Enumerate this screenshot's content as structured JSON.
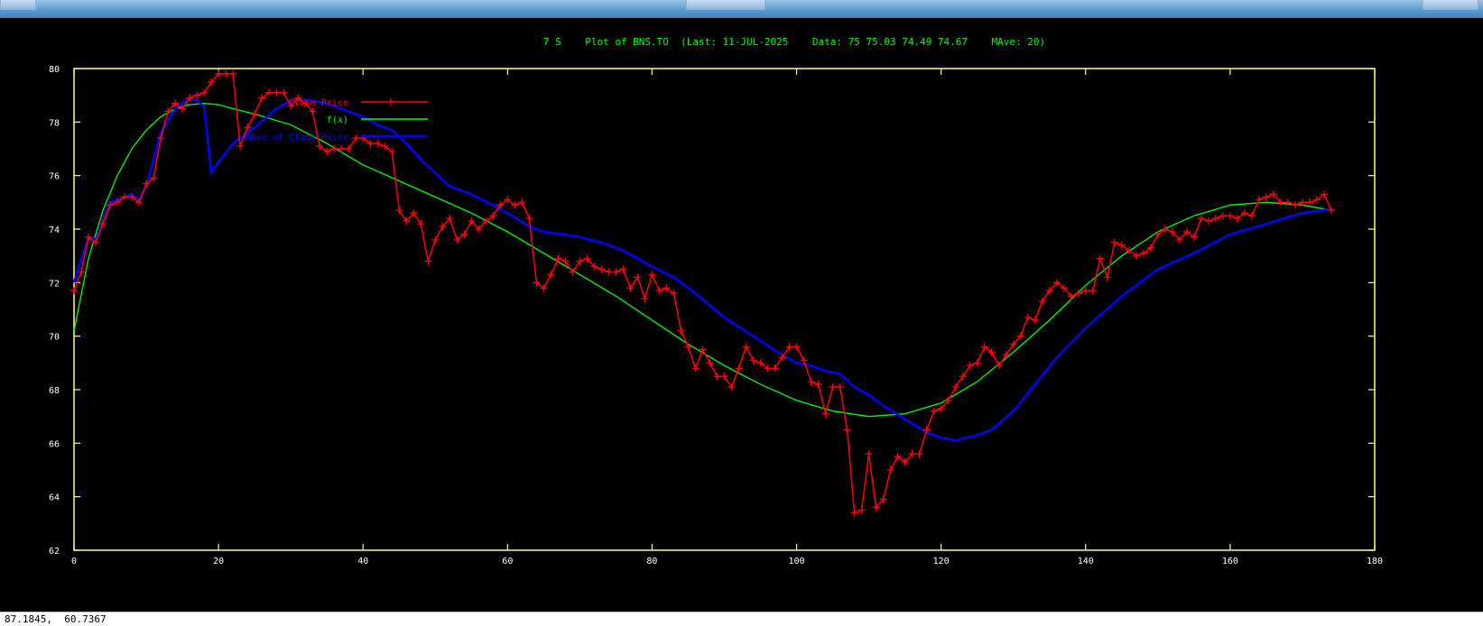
{
  "window": {
    "coords": "87.1845,  60.7367"
  },
  "chart_data": {
    "type": "line",
    "title": "7 S    Plot of BNS.TO  (Last: 11-JUL-2025    Data: 75 75.03 74.49 74.67    MAve: 20)",
    "xlabel": "",
    "ylabel": "",
    "xlim": [
      0,
      180
    ],
    "ylim": [
      62,
      80
    ],
    "x_ticks": [
      0,
      20,
      40,
      60,
      80,
      100,
      120,
      140,
      160,
      180
    ],
    "y_ticks": [
      62,
      64,
      66,
      68,
      70,
      72,
      74,
      76,
      78,
      80
    ],
    "grid": false,
    "legend_position": "top-left",
    "colors": {
      "background": "#000000",
      "axes": "#ffff80",
      "title": "#00ff00",
      "close": "#ff0000",
      "fit": "#00ff00",
      "mave": "#0000ff"
    },
    "series": [
      {
        "name": "Close Price",
        "marker": "plus",
        "color": "#ff0000",
        "points": [
          [
            0,
            71.7
          ],
          [
            1,
            72.4
          ],
          [
            2,
            73.7
          ],
          [
            3,
            73.5
          ],
          [
            4,
            74.2
          ],
          [
            5,
            74.9
          ],
          [
            6,
            75.0
          ],
          [
            7,
            75.2
          ],
          [
            8,
            75.2
          ],
          [
            9,
            75.0
          ],
          [
            10,
            75.7
          ],
          [
            11,
            75.9
          ],
          [
            12,
            77.4
          ],
          [
            13,
            78.4
          ],
          [
            14,
            78.7
          ],
          [
            15,
            78.5
          ],
          [
            16,
            78.9
          ],
          [
            17,
            79.0
          ],
          [
            18,
            79.1
          ],
          [
            19,
            79.5
          ],
          [
            20,
            79.8
          ],
          [
            21,
            79.8
          ],
          [
            22,
            79.8
          ],
          [
            23,
            77.1
          ],
          [
            24,
            77.8
          ],
          [
            25,
            78.3
          ],
          [
            26,
            78.9
          ],
          [
            27,
            79.1
          ],
          [
            28,
            79.1
          ],
          [
            29,
            79.1
          ],
          [
            30,
            78.6
          ],
          [
            31,
            78.9
          ],
          [
            32,
            78.7
          ],
          [
            33,
            78.4
          ],
          [
            34,
            77.1
          ],
          [
            35,
            76.9
          ],
          [
            36,
            77.0
          ],
          [
            37,
            77.0
          ],
          [
            38,
            77.0
          ],
          [
            39,
            77.4
          ],
          [
            40,
            77.4
          ],
          [
            41,
            77.2
          ],
          [
            42,
            77.2
          ],
          [
            43,
            77.1
          ],
          [
            44,
            76.9
          ],
          [
            45,
            74.7
          ],
          [
            46,
            74.3
          ],
          [
            47,
            74.6
          ],
          [
            48,
            74.2
          ],
          [
            49,
            72.8
          ],
          [
            50,
            73.6
          ],
          [
            51,
            74.1
          ],
          [
            52,
            74.4
          ],
          [
            53,
            73.6
          ],
          [
            54,
            73.8
          ],
          [
            55,
            74.3
          ],
          [
            56,
            74.0
          ],
          [
            57,
            74.3
          ],
          [
            58,
            74.5
          ],
          [
            59,
            74.9
          ],
          [
            60,
            75.1
          ],
          [
            61,
            74.9
          ],
          [
            62,
            75.0
          ],
          [
            63,
            74.4
          ],
          [
            64,
            72.0
          ],
          [
            65,
            71.8
          ],
          [
            66,
            72.3
          ],
          [
            67,
            72.9
          ],
          [
            68,
            72.8
          ],
          [
            69,
            72.4
          ],
          [
            70,
            72.8
          ],
          [
            71,
            72.9
          ],
          [
            72,
            72.6
          ],
          [
            73,
            72.5
          ],
          [
            74,
            72.4
          ],
          [
            75,
            72.4
          ],
          [
            76,
            72.5
          ],
          [
            77,
            71.8
          ],
          [
            78,
            72.2
          ],
          [
            79,
            71.4
          ],
          [
            80,
            72.3
          ],
          [
            81,
            71.7
          ],
          [
            82,
            71.8
          ],
          [
            83,
            71.6
          ],
          [
            84,
            70.2
          ],
          [
            85,
            69.6
          ],
          [
            86,
            68.8
          ],
          [
            87,
            69.5
          ],
          [
            88,
            69.0
          ],
          [
            89,
            68.5
          ],
          [
            90,
            68.5
          ],
          [
            91,
            68.1
          ],
          [
            92,
            68.8
          ],
          [
            93,
            69.6
          ],
          [
            94,
            69.1
          ],
          [
            95,
            69.0
          ],
          [
            96,
            68.8
          ],
          [
            97,
            68.8
          ],
          [
            98,
            69.2
          ],
          [
            99,
            69.6
          ],
          [
            100,
            69.6
          ],
          [
            101,
            69.1
          ],
          [
            102,
            68.3
          ],
          [
            103,
            68.2
          ],
          [
            104,
            67.1
          ],
          [
            105,
            68.1
          ],
          [
            106,
            68.1
          ],
          [
            107,
            66.5
          ],
          [
            108,
            63.4
          ],
          [
            109,
            63.5
          ],
          [
            110,
            65.6
          ],
          [
            111,
            63.6
          ],
          [
            112,
            63.9
          ],
          [
            113,
            65.0
          ],
          [
            114,
            65.5
          ],
          [
            115,
            65.3
          ],
          [
            116,
            65.6
          ],
          [
            117,
            65.6
          ],
          [
            118,
            66.5
          ],
          [
            119,
            67.2
          ],
          [
            120,
            67.3
          ],
          [
            121,
            67.6
          ],
          [
            122,
            68.1
          ],
          [
            123,
            68.5
          ],
          [
            124,
            68.9
          ],
          [
            125,
            69.0
          ],
          [
            126,
            69.6
          ],
          [
            127,
            69.4
          ],
          [
            128,
            68.9
          ],
          [
            129,
            69.3
          ],
          [
            130,
            69.7
          ],
          [
            131,
            70.0
          ],
          [
            132,
            70.7
          ],
          [
            133,
            70.6
          ],
          [
            134,
            71.3
          ],
          [
            135,
            71.7
          ],
          [
            136,
            72.0
          ],
          [
            137,
            71.8
          ],
          [
            138,
            71.5
          ],
          [
            139,
            71.6
          ],
          [
            140,
            71.7
          ],
          [
            141,
            71.7
          ],
          [
            142,
            72.9
          ],
          [
            143,
            72.2
          ],
          [
            144,
            73.5
          ],
          [
            145,
            73.4
          ],
          [
            146,
            73.2
          ],
          [
            147,
            73.0
          ],
          [
            148,
            73.1
          ],
          [
            149,
            73.3
          ],
          [
            150,
            73.8
          ],
          [
            151,
            74.0
          ],
          [
            152,
            73.9
          ],
          [
            153,
            73.6
          ],
          [
            154,
            73.9
          ],
          [
            155,
            73.7
          ],
          [
            156,
            74.4
          ],
          [
            157,
            74.3
          ],
          [
            158,
            74.4
          ],
          [
            159,
            74.5
          ],
          [
            160,
            74.5
          ],
          [
            161,
            74.4
          ],
          [
            162,
            74.6
          ],
          [
            163,
            74.5
          ],
          [
            164,
            75.1
          ],
          [
            165,
            75.2
          ],
          [
            166,
            75.3
          ],
          [
            167,
            75.0
          ],
          [
            168,
            75.0
          ],
          [
            169,
            74.9
          ],
          [
            170,
            75.0
          ],
          [
            171,
            75.0
          ],
          [
            172,
            75.1
          ],
          [
            173,
            75.3
          ],
          [
            174,
            74.7
          ]
        ]
      },
      {
        "name": "f(x)",
        "color": "#00ff00",
        "points": [
          [
            0,
            70.2
          ],
          [
            2,
            72.9
          ],
          [
            4,
            74.7
          ],
          [
            6,
            76.0
          ],
          [
            8,
            77.0
          ],
          [
            10,
            77.7
          ],
          [
            12,
            78.2
          ],
          [
            14,
            78.5
          ],
          [
            16,
            78.65
          ],
          [
            18,
            78.7
          ],
          [
            20,
            78.65
          ],
          [
            22,
            78.5
          ],
          [
            25,
            78.3
          ],
          [
            30,
            77.9
          ],
          [
            35,
            77.2
          ],
          [
            40,
            76.4
          ],
          [
            45,
            75.8
          ],
          [
            50,
            75.2
          ],
          [
            55,
            74.6
          ],
          [
            60,
            73.9
          ],
          [
            65,
            73.1
          ],
          [
            70,
            72.3
          ],
          [
            75,
            71.5
          ],
          [
            80,
            70.6
          ],
          [
            85,
            69.7
          ],
          [
            90,
            68.9
          ],
          [
            95,
            68.2
          ],
          [
            100,
            67.6
          ],
          [
            105,
            67.2
          ],
          [
            110,
            67.0
          ],
          [
            115,
            67.1
          ],
          [
            120,
            67.5
          ],
          [
            125,
            68.3
          ],
          [
            130,
            69.4
          ],
          [
            135,
            70.6
          ],
          [
            140,
            71.9
          ],
          [
            145,
            73.0
          ],
          [
            150,
            73.9
          ],
          [
            155,
            74.5
          ],
          [
            160,
            74.9
          ],
          [
            165,
            75.0
          ],
          [
            170,
            74.9
          ],
          [
            174,
            74.7
          ]
        ]
      },
      {
        "name": "MAve of Close Price",
        "color": "#0000ff",
        "points": [
          [
            0,
            72.0
          ],
          [
            2,
            73.7
          ],
          [
            3,
            73.6
          ],
          [
            5,
            75.0
          ],
          [
            8,
            75.3
          ],
          [
            9,
            75.1
          ],
          [
            10,
            75.6
          ],
          [
            12,
            77.6
          ],
          [
            14,
            78.5
          ],
          [
            16,
            78.9
          ],
          [
            17,
            78.8
          ],
          [
            18,
            78.6
          ],
          [
            19,
            76.1
          ],
          [
            20,
            76.5
          ],
          [
            22,
            77.2
          ],
          [
            25,
            77.8
          ],
          [
            28,
            78.5
          ],
          [
            30,
            78.8
          ],
          [
            32,
            78.85
          ],
          [
            35,
            78.7
          ],
          [
            38,
            78.4
          ],
          [
            40,
            78.2
          ],
          [
            42,
            77.9
          ],
          [
            44,
            77.7
          ],
          [
            46,
            77.2
          ],
          [
            48,
            76.6
          ],
          [
            50,
            76.1
          ],
          [
            52,
            75.6
          ],
          [
            55,
            75.3
          ],
          [
            58,
            74.9
          ],
          [
            60,
            74.6
          ],
          [
            63,
            74.1
          ],
          [
            65,
            73.9
          ],
          [
            68,
            73.8
          ],
          [
            70,
            73.7
          ],
          [
            73,
            73.5
          ],
          [
            76,
            73.2
          ],
          [
            80,
            72.6
          ],
          [
            83,
            72.2
          ],
          [
            86,
            71.6
          ],
          [
            90,
            70.7
          ],
          [
            94,
            70.0
          ],
          [
            98,
            69.3
          ],
          [
            100,
            69.0
          ],
          [
            102,
            68.9
          ],
          [
            104,
            68.7
          ],
          [
            106,
            68.6
          ],
          [
            108,
            68.1
          ],
          [
            110,
            67.8
          ],
          [
            112,
            67.4
          ],
          [
            115,
            66.9
          ],
          [
            118,
            66.4
          ],
          [
            120,
            66.2
          ],
          [
            122,
            66.1
          ],
          [
            125,
            66.3
          ],
          [
            127,
            66.5
          ],
          [
            130,
            67.2
          ],
          [
            133,
            68.2
          ],
          [
            136,
            69.2
          ],
          [
            140,
            70.3
          ],
          [
            145,
            71.5
          ],
          [
            150,
            72.5
          ],
          [
            155,
            73.1
          ],
          [
            160,
            73.8
          ],
          [
            165,
            74.2
          ],
          [
            170,
            74.6
          ],
          [
            174,
            74.75
          ]
        ]
      }
    ]
  }
}
